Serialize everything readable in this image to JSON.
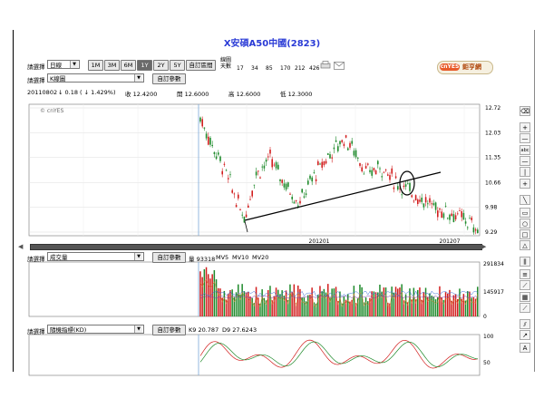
{
  "title": "X安碩A50中國(2823)",
  "toolbar": {
    "select_label": "請選擇",
    "period_select": "日線",
    "ranges": [
      "1M",
      "3M",
      "6M",
      "1Y",
      "2Y",
      "5Y",
      "自訂區間"
    ],
    "active_range": "1Y",
    "ma_label_top": "線圖",
    "ma_label_bottom": "天數",
    "ma_days": [
      "17",
      "34",
      "85",
      "170",
      "212",
      "426"
    ]
  },
  "row2": {
    "select_label": "請選擇",
    "chart_select": "K線圖",
    "custom_params": "自訂參數"
  },
  "quote": {
    "date": "20110802",
    "change": "↓ 0.18 ( ↓ 1.429%)",
    "close": "收 12.4200",
    "open": "開 12.6000",
    "high": "高 12.6000",
    "low": "低 12.3000"
  },
  "logo": {
    "badge": "cnYES",
    "text": "鉅亨網"
  },
  "main_chart": {
    "watermark": "© cnYES",
    "y_ticks": [
      "12.72",
      "12.03",
      "11.35",
      "10.66",
      "9.98",
      "9.29"
    ],
    "x_ticks": [
      "201201",
      "201207"
    ]
  },
  "volume_panel": {
    "select_label": "請選擇",
    "select_value": "成交量",
    "custom_params": "自訂參數",
    "legend": [
      "量 93318",
      "MV5",
      "MV10",
      "MV20"
    ],
    "y_ticks": [
      "291834",
      "145917",
      "0"
    ]
  },
  "kd_panel": {
    "select_label": "請選擇",
    "select_value": "隨機指標(KD)",
    "custom_params": "自訂參數",
    "legend": [
      "K9 20.787",
      "D9 27.6243"
    ],
    "y_ticks": [
      "100",
      "50"
    ]
  },
  "tools": [
    "eraser-icon",
    "plus-icon",
    "minus-icon",
    "abc-icon",
    "hline-icon",
    "vline-icon",
    "cross-icon",
    "line-icon",
    "ellipse-icon",
    "circle-icon",
    "rect-icon",
    "triangle-icon",
    "bars-icon",
    "fib-icon",
    "gann-icon",
    "grid-icon",
    "fan-icon",
    "channel-icon",
    "arrow-icon",
    "text-icon"
  ]
}
